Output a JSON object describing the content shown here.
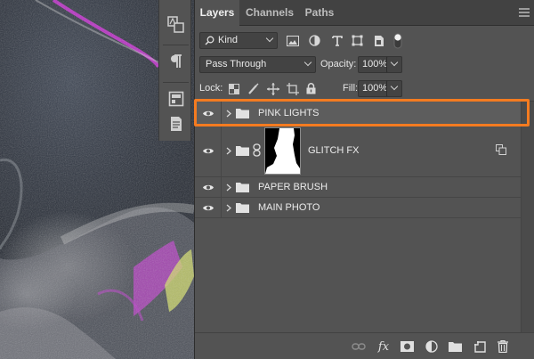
{
  "tabs": [
    {
      "label": "Layers",
      "active": true
    },
    {
      "label": "Channels",
      "active": false
    },
    {
      "label": "Paths",
      "active": false
    }
  ],
  "filter": {
    "kind_label": "Kind"
  },
  "blend": {
    "mode": "Pass Through",
    "opacity_label": "Opacity:",
    "opacity_value": "100%"
  },
  "lock": {
    "label": "Lock:",
    "fill_label": "Fill:",
    "fill_value": "100%"
  },
  "layers": [
    {
      "name": "PINK LIGHTS",
      "type": "group",
      "visible": true,
      "selected": true
    },
    {
      "name": "GLITCH FX",
      "type": "group",
      "visible": true,
      "has_mask": true,
      "linked": true
    },
    {
      "name": "PAPER BRUSH",
      "type": "group",
      "visible": true
    },
    {
      "name": "MAIN PHOTO",
      "type": "group",
      "visible": true
    }
  ],
  "icons": {
    "toolstrip": [
      "character-swatch-icon",
      "paragraph-icon",
      "properties-icon",
      "notes-icon"
    ],
    "footer": [
      "link-layers-icon",
      "fx-icon",
      "add-mask-icon",
      "adjustment-layer-icon",
      "new-group-icon",
      "new-layer-icon",
      "trash-icon"
    ]
  },
  "fx_label": "fx",
  "colors": {
    "highlight": "#f47b20",
    "panel": "#535353",
    "tabbar": "#424242"
  }
}
